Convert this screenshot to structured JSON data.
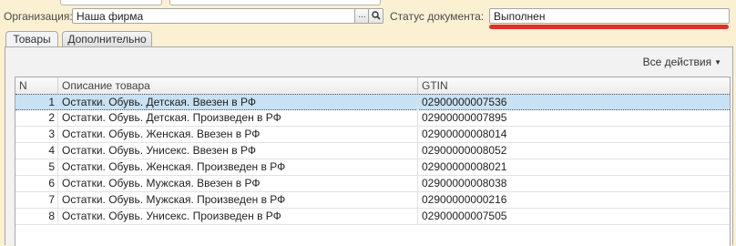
{
  "header": {
    "org_label": "Организация:",
    "org_value": "Наша фирма",
    "org_button_label": "...",
    "status_label": "Статус документа:",
    "status_value": "Выполнен",
    "highlight_color": "#e0302a"
  },
  "tabs": [
    {
      "label": "Товары",
      "active": true
    },
    {
      "label": "Дополнительно",
      "active": false
    }
  ],
  "toolbar": {
    "all_actions_label": "Все действия"
  },
  "table": {
    "columns": [
      "N",
      "Описание товара",
      "GTIN"
    ],
    "rows": [
      {
        "n": "1",
        "desc": "Остатки. Обувь. Детская. Ввезен в РФ",
        "gtin": "02900000007536",
        "selected": true
      },
      {
        "n": "2",
        "desc": "Остатки. Обувь. Детская. Произведен в РФ",
        "gtin": "02900000007895"
      },
      {
        "n": "3",
        "desc": "Остатки. Обувь. Женская. Ввезен в РФ",
        "gtin": "02900000008014"
      },
      {
        "n": "4",
        "desc": "Остатки. Обувь. Унисекс. Ввезен в РФ",
        "gtin": "02900000008052"
      },
      {
        "n": "5",
        "desc": "Остатки. Обувь. Женская. Произведен в РФ",
        "gtin": "02900000008021"
      },
      {
        "n": "6",
        "desc": "Остатки. Обувь. Мужская. Ввезен в РФ",
        "gtin": "02900000008038"
      },
      {
        "n": "7",
        "desc": "Остатки. Обувь. Мужская. Произведен в РФ",
        "gtin": "02900000000216"
      },
      {
        "n": "8",
        "desc": "Остатки. Обувь. Унисекс. Произведен в РФ",
        "gtin": "02900000007505"
      }
    ]
  }
}
